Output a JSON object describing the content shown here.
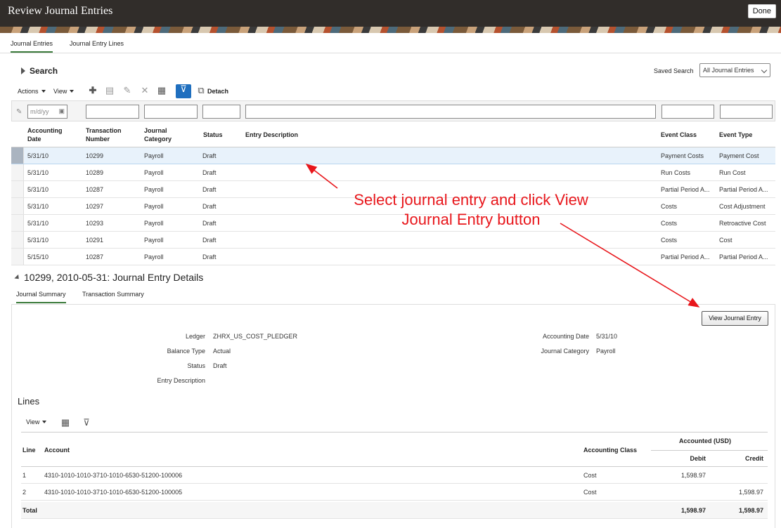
{
  "window": {
    "title": "Review Journal Entries",
    "done_label": "Done"
  },
  "top_tabs": [
    {
      "label": "Journal Entries",
      "active": true
    },
    {
      "label": "Journal Entry Lines",
      "active": false
    }
  ],
  "search": {
    "label": "Search",
    "saved_search_label": "Saved Search",
    "saved_search_value": "All Journal Entries"
  },
  "toolbar": {
    "actions_label": "Actions",
    "view_label": "View",
    "detach_label": "Detach"
  },
  "filter": {
    "date_placeholder": "m/d/yy"
  },
  "grid": {
    "columns": [
      "Accounting Date",
      "Transaction Number",
      "Journal Category",
      "Status",
      "Entry Description",
      "Event Class",
      "Event Type"
    ],
    "rows": [
      [
        "5/31/10",
        "10299",
        "Payroll",
        "Draft",
        "",
        "Payment Costs",
        "Payment Cost"
      ],
      [
        "5/31/10",
        "10289",
        "Payroll",
        "Draft",
        "",
        "Run Costs",
        "Run Cost"
      ],
      [
        "5/31/10",
        "10287",
        "Payroll",
        "Draft",
        "",
        "Partial Period A...",
        "Partial Period A..."
      ],
      [
        "5/31/10",
        "10297",
        "Payroll",
        "Draft",
        "",
        "Costs",
        "Cost Adjustment"
      ],
      [
        "5/31/10",
        "10293",
        "Payroll",
        "Draft",
        "",
        "Costs",
        "Retroactive Cost"
      ],
      [
        "5/31/10",
        "10291",
        "Payroll",
        "Draft",
        "",
        "Costs",
        "Cost"
      ],
      [
        "5/15/10",
        "10287",
        "Payroll",
        "Draft",
        "",
        "Partial Period A...",
        "Partial Period A..."
      ]
    ]
  },
  "details": {
    "title": "10299, 2010-05-31: Journal Entry Details",
    "tabs": [
      {
        "label": "Journal Summary",
        "active": true
      },
      {
        "label": "Transaction Summary",
        "active": false
      }
    ],
    "view_journal_entry_label": "View Journal Entry",
    "fields_left": [
      {
        "label": "Ledger",
        "value": "ZHRX_US_COST_PLEDGER"
      },
      {
        "label": "Balance Type",
        "value": "Actual"
      },
      {
        "label": "Status",
        "value": "Draft"
      },
      {
        "label": "Entry Description",
        "value": ""
      }
    ],
    "fields_right": [
      {
        "label": "Accounting Date",
        "value": "5/31/10"
      },
      {
        "label": "Journal Category",
        "value": "Payroll"
      }
    ]
  },
  "lines": {
    "title": "Lines",
    "view_label": "View",
    "headers": {
      "line": "Line",
      "account": "Account",
      "accounting_class": "Accounting Class",
      "accounted": "Accounted (USD)",
      "debit": "Debit",
      "credit": "Credit"
    },
    "rows": [
      {
        "line": "1",
        "account": "4310-1010-1010-3710-1010-6530-51200-100006",
        "class": "Cost",
        "debit": "1,598.97",
        "credit": ""
      },
      {
        "line": "2",
        "account": "4310-1010-1010-3710-1010-6530-51200-100005",
        "class": "Cost",
        "debit": "",
        "credit": "1,598.97"
      }
    ],
    "total": {
      "label": "Total",
      "debit": "1,598.97",
      "credit": "1,598.97"
    }
  },
  "annotation": {
    "line1": "Select journal entry and click View",
    "line2": "Journal Entry button",
    "color": "#e8161b"
  },
  "colors": {
    "header_bg": "#312d2a",
    "accent_blue": "#1f6fbf",
    "selected_row": "#e8f2fb"
  }
}
